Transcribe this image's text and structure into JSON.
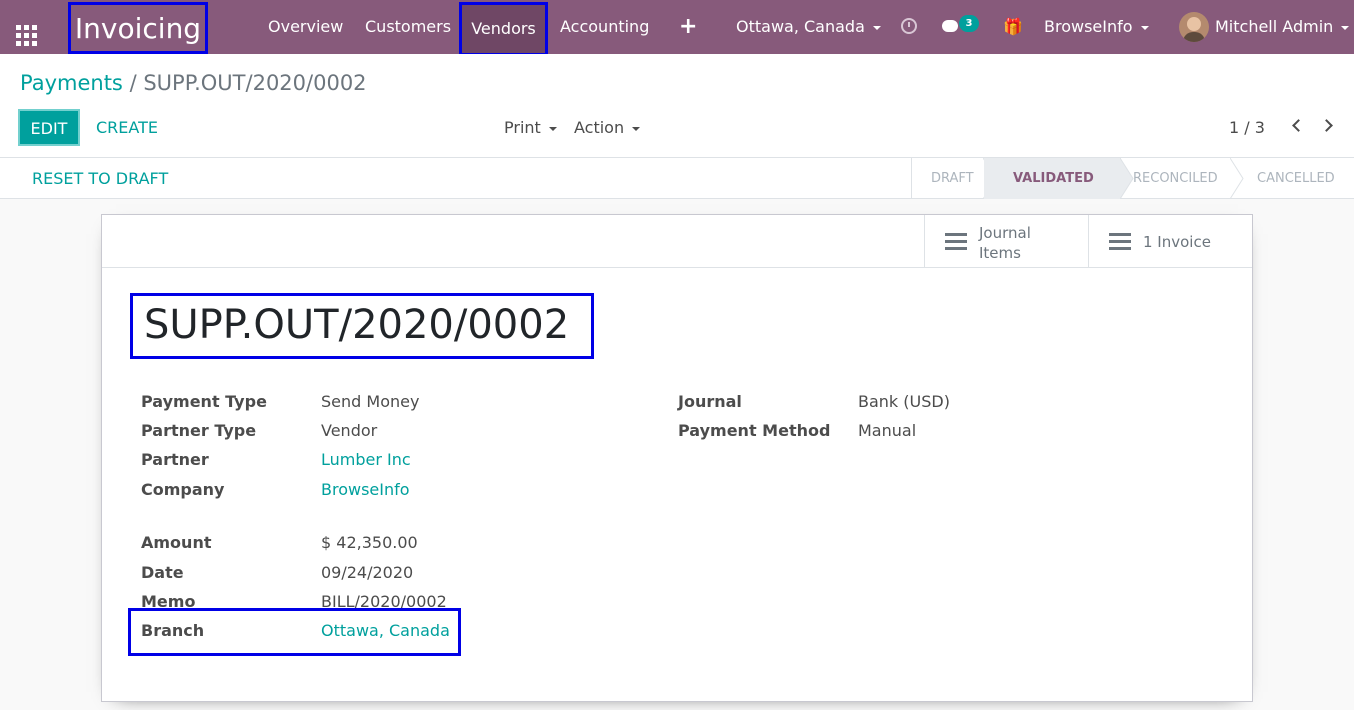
{
  "topbar": {
    "app_title": "Invoicing",
    "menu": [
      "Overview",
      "Customers",
      "Vendors",
      "Accounting"
    ],
    "branch": "Ottawa, Canada",
    "chat_badge": "3",
    "company": "BrowseInfo",
    "user": "Mitchell Admin",
    "colors": {
      "bar": "#875a7b",
      "highlight_box": "#0000e6",
      "badge": "#00a09d"
    }
  },
  "breadcrumb": {
    "parent": "Payments",
    "separator": "/",
    "current": "SUPP.OUT/2020/0002"
  },
  "controls": {
    "edit": "EDIT",
    "create": "CREATE",
    "print": "Print",
    "action": "Action",
    "pager": "1 / 3"
  },
  "statusbar": {
    "reset": "RESET TO DRAFT",
    "stages": [
      "DRAFT",
      "VALIDATED",
      "RECONCILED",
      "CANCELLED"
    ],
    "active_stage": "VALIDATED"
  },
  "smart_buttons": {
    "journal_line1": "Journal",
    "journal_line2": "Items",
    "invoice": "1 Invoice"
  },
  "record": {
    "name": "SUPP.OUT/2020/0002",
    "left": [
      {
        "label": "Payment Type",
        "value": "Send Money"
      },
      {
        "label": "Partner Type",
        "value": "Vendor"
      },
      {
        "label": "Partner",
        "value": "Lumber Inc"
      },
      {
        "label": "Company",
        "value": "BrowseInfo"
      },
      {
        "label": "Amount",
        "value": "$ 42,350.00"
      },
      {
        "label": "Date",
        "value": "09/24/2020"
      },
      {
        "label": "Memo",
        "value": "BILL/2020/0002"
      },
      {
        "label": "Branch",
        "value": "Ottawa, Canada"
      }
    ],
    "right": [
      {
        "label": "Journal",
        "value": "Bank (USD)"
      },
      {
        "label": "Payment Method",
        "value": "Manual"
      }
    ]
  }
}
